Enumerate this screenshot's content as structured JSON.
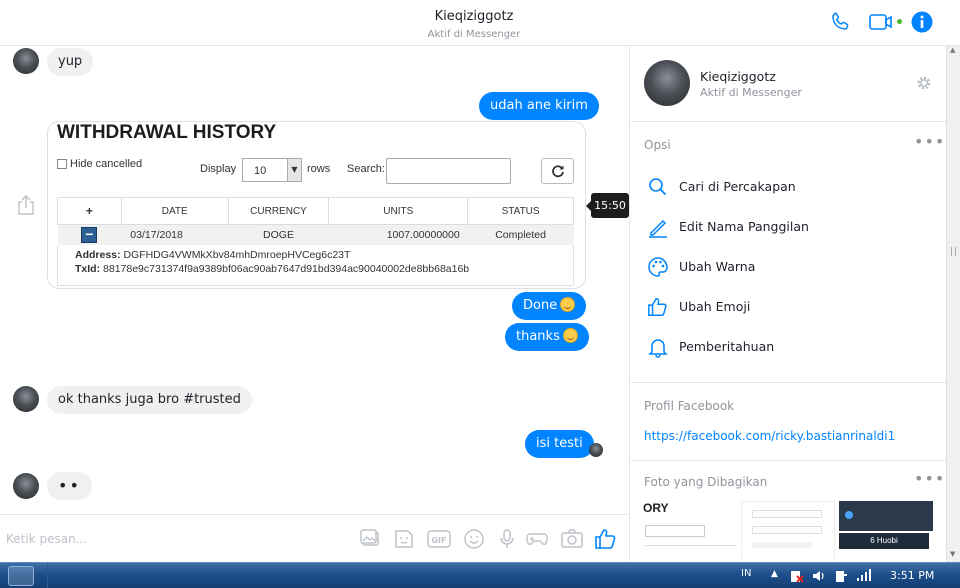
{
  "header": {
    "contact_name": "Kieqiziggotz",
    "status": "Aktif di Messenger"
  },
  "chat": {
    "messages": [
      {
        "text": "yup"
      },
      {
        "text": "udah ane kirim"
      },
      {
        "text": "Done"
      },
      {
        "text": "thanks"
      },
      {
        "text": "ok thanks juga bro #trusted"
      },
      {
        "text": "isi testi"
      },
      {
        "text": "••"
      }
    ],
    "timestamp_tooltip": "15:50"
  },
  "shared_image": {
    "title": "WITHDRAWAL HISTORY",
    "hide_cancelled_label": "Hide cancelled",
    "display_label": "Display",
    "rows_value": "10",
    "rows_label": "rows",
    "search_label": "Search:",
    "columns": [
      "+",
      "DATE",
      "CURRENCY",
      "UNITS",
      "STATUS"
    ],
    "row": {
      "date": "03/17/2018",
      "currency": "DOGE",
      "units": "1007.00000000",
      "status": "Completed"
    },
    "address_label": "Address:",
    "address": "DGFHDG4VWMkXbv84mhDmroepHVCeg6c23T",
    "txid_label": "TxId:",
    "txid": "88178e9c731374f9a9389bf06ac90ab7647d91bd394ac90040002de8bb68a16b"
  },
  "composer": {
    "placeholder": "Ketik pesan..."
  },
  "panel": {
    "name": "Kieqiziggotz",
    "status": "Aktif di Messenger",
    "options_label": "Opsi",
    "options": [
      {
        "label": "Cari di Percakapan",
        "icon": "search-icon"
      },
      {
        "label": "Edit Nama Panggilan",
        "icon": "pencil-icon"
      },
      {
        "label": "Ubah Warna",
        "icon": "palette-icon"
      },
      {
        "label": "Ubah Emoji",
        "icon": "thumbs-up-icon"
      },
      {
        "label": "Pemberitahuan",
        "icon": "bell-icon"
      }
    ],
    "facebook_profile_label": "Profil Facebook",
    "facebook_url": "https://facebook.com/ricky.bastianrinaldi1",
    "shared_photos_label": "Foto yang Dibagikan",
    "thumb1_text": "ORY",
    "thumb2_text": "6 Huobi"
  },
  "taskbar": {
    "language": "IN",
    "time": "3:51 PM"
  },
  "colors": {
    "accent": "#0084ff",
    "incoming_bubble": "#f1f0f0",
    "taskbar": "#1e4f8a"
  }
}
